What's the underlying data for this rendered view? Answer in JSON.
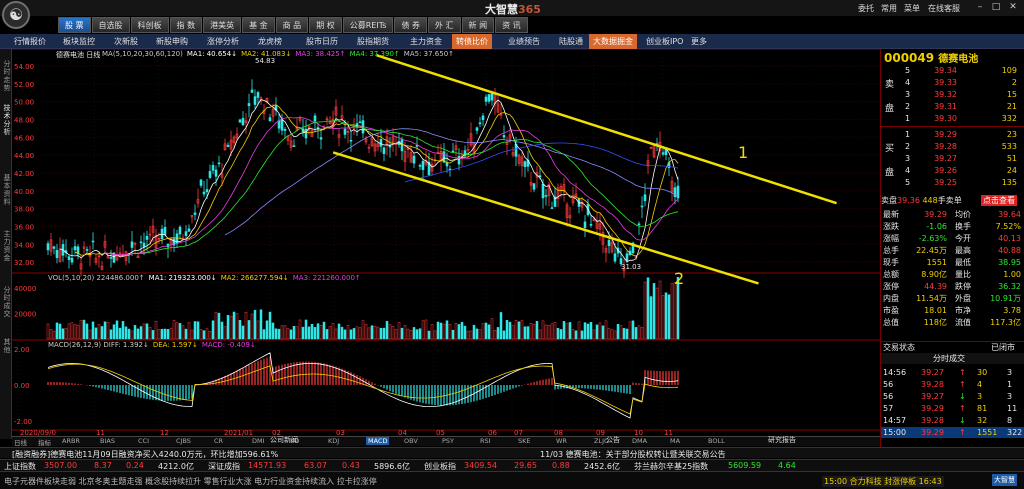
{
  "app": {
    "brand_main": "大智慧",
    "brand_num": "365"
  },
  "window_links": [
    "委托",
    "常用",
    "菜单",
    "在线客服"
  ],
  "menus": [
    "股 票",
    "自选股",
    "科创板",
    "指 数",
    "港美英",
    "基 金",
    "商 品",
    "期 权",
    "公募REITs",
    "债 券",
    "外 汇",
    "新 闻",
    "资 讯"
  ],
  "subtoolbar": [
    "行情报价",
    "板块监控",
    "次新股",
    "新股申购",
    "涨停分析",
    "龙虎榜",
    "股市日历",
    "股指期货",
    "主力资金",
    "转债比价",
    "业绩预告",
    "陆股通",
    "大数据掘金",
    "创业板IPO",
    "更多"
  ],
  "left_tabs": [
    "分时走势",
    "技术分析",
    "基本资料",
    "主力资金",
    "分时成交",
    "其他"
  ],
  "chart": {
    "stock_label": "德赛电池 日线",
    "ma_legend": [
      {
        "text": "MA(5,10,20,30,60,120)",
        "color": "#c8c8c8"
      },
      {
        "text": "MA1: 40.654↓",
        "color": "#ffffff"
      },
      {
        "text": "MA2: 41.083↓",
        "color": "#f0d000"
      },
      {
        "text": "MA3: 38.425↑",
        "color": "#e040e0"
      },
      {
        "text": "MA4: 37.390↑",
        "color": "#2ee62e"
      },
      {
        "text": "MA5: 37.650↑",
        "color": "#c8c8c8"
      }
    ],
    "peak_label": "54.83",
    "low_label": "31.03",
    "price_axis": [
      "54.00",
      "52.00",
      "50.00",
      "48.00",
      "46.00",
      "44.00",
      "42.00",
      "40.00",
      "38.00",
      "36.00",
      "34.00",
      "32.00"
    ],
    "vol_legend": [
      {
        "text": "VOL(5,10,20) 224486.000↑",
        "color": "#c8c8c8"
      },
      {
        "text": "MA1: 219323.000↓",
        "color": "#ffffff"
      },
      {
        "text": "MA2: 266277.594↓",
        "color": "#f0d000"
      },
      {
        "text": "MA3: 221260.000↑",
        "color": "#e040e0"
      }
    ],
    "vol_axis": [
      "40000",
      "20000"
    ],
    "macd_legend": [
      {
        "text": "MACD(26,12,9) DIFF: 1.392↓",
        "color": "#c8c8c8"
      },
      {
        "text": "DEA: 1.597↓",
        "color": "#f0d000"
      },
      {
        "text": "MACD: -0.409↓",
        "color": "#e040e0"
      }
    ],
    "macd_axis": [
      "2.00",
      "0.00",
      "-2.00"
    ],
    "date_labels": [
      "2020/09/0",
      "11",
      "12",
      "2021/01",
      "02",
      "03",
      "04",
      "05",
      "06",
      "07",
      "08",
      "09",
      "10",
      "11"
    ],
    "channel_labels": [
      "1",
      "2"
    ]
  },
  "chart_data": {
    "type": "candlestick",
    "title": "德赛电池 日线",
    "ylabel": "",
    "ylim": [
      31,
      55
    ],
    "upper_line": {
      "points": [
        [
          0.42,
          55.2
        ],
        [
          0.95,
          38.6
        ]
      ]
    },
    "lower_line": {
      "points": [
        [
          0.37,
          44.3
        ],
        [
          0.86,
          29.6
        ]
      ]
    },
    "highlights": {
      "high": 54.83,
      "low": 31.03
    }
  },
  "indicator_tabs": [
    "日线",
    "指标",
    "ARBR",
    "BIAS",
    "CCI",
    "CJBS",
    "CR",
    "DMI",
    "KD",
    "KDJ",
    "MACD",
    "OBV",
    "PSY",
    "RSI",
    "SKE",
    "WR",
    "ZLJC",
    "DMA",
    "MA",
    "BOLL"
  ],
  "bottom_tabs": [
    "公司新闻",
    "公告",
    "研究报告"
  ],
  "quote": {
    "code": "000049",
    "name": "德赛电池",
    "asks": [
      {
        "lvl": "5",
        "price": "39.34",
        "vol": "109"
      },
      {
        "lvl": "4",
        "price": "39.33",
        "vol": "2"
      },
      {
        "lvl": "3",
        "price": "39.32",
        "vol": "15"
      },
      {
        "lvl": "2",
        "price": "39.31",
        "vol": "21"
      },
      {
        "lvl": "1",
        "price": "39.30",
        "vol": "332"
      }
    ],
    "bids": [
      {
        "lvl": "1",
        "price": "39.29",
        "vol": "23"
      },
      {
        "lvl": "2",
        "price": "39.28",
        "vol": "533"
      },
      {
        "lvl": "3",
        "price": "39.27",
        "vol": "51"
      },
      {
        "lvl": "4",
        "price": "39.26",
        "vol": "24"
      },
      {
        "lvl": "5",
        "price": "39.25",
        "vol": "135"
      }
    ],
    "side_ask": "卖",
    "side_bid": "买",
    "side_pan": "盘",
    "sellpan_label": "卖盘",
    "sellpan_price": "39.36",
    "sellpan_vol": "448",
    "sellpan_suffix": "手卖单",
    "sellpan_btn": "点击查看",
    "stats": [
      [
        "最新",
        "39.29",
        "均价",
        "39.64"
      ],
      [
        "涨跌",
        "-1.06",
        "换手",
        "7.52%"
      ],
      [
        "涨幅",
        "-2.63%",
        "今开",
        "40.13"
      ],
      [
        "总手",
        "22.45万",
        "最高",
        "40.88"
      ],
      [
        "现手",
        "1551",
        "最低",
        "38.95"
      ],
      [
        "总额",
        "8.90亿",
        "量比",
        "1.00"
      ],
      [
        "涨停",
        "44.39",
        "跌停",
        "36.32"
      ],
      [
        "内盘",
        "11.54万",
        "外盘",
        "10.91万"
      ],
      [
        "市盈",
        "18.01",
        "市净",
        "3.78"
      ],
      [
        "总值",
        "118亿",
        "流值",
        "117.3亿"
      ]
    ],
    "trade_header": "交易状态",
    "trade_status": "已闭市",
    "ticks_title": "分时成交",
    "ticks": [
      {
        "t": "14:56",
        "p": "39.27",
        "v": "30",
        "n": "3"
      },
      {
        "t": "56",
        "p": "39.28",
        "v": "4",
        "n": "1"
      },
      {
        "t": "56",
        "p": "39.27",
        "v": "3",
        "n": "3"
      },
      {
        "t": "57",
        "p": "39.29",
        "v": "81",
        "n": "11"
      },
      {
        "t": "14:57",
        "p": "39.28",
        "v": "32",
        "n": "8"
      },
      {
        "t": "15:00",
        "p": "39.29",
        "v": "1551",
        "n": "322"
      }
    ]
  },
  "news_bar": "[融资融券]德赛电池11月09日融资净买入4240.0万元，环比增加596.61%",
  "news_suffix": "11/03 德赛电池：关于部分股权转让暨关联交易公告",
  "ticker": [
    {
      "name": "上证指数",
      "val": "3507.00",
      "color": "#ff3b3b"
    },
    {
      "name": "",
      "val": "8.37",
      "color": "#ff3b3b"
    },
    {
      "name": "",
      "val": "0.24",
      "color": "#ff3b3b"
    },
    {
      "name": "",
      "val": "4212.0亿",
      "color": "#e8e8e8"
    },
    {
      "name": "深证成指",
      "val": "14571.93",
      "color": "#ff3b3b"
    },
    {
      "name": "",
      "val": "63.07",
      "color": "#ff3b3b"
    },
    {
      "name": "",
      "val": "0.43",
      "color": "#ff3b3b"
    },
    {
      "name": "",
      "val": "5896.6亿",
      "color": "#e8e8e8"
    },
    {
      "name": "创业板指",
      "val": "3409.54",
      "color": "#ff3b3b"
    },
    {
      "name": "",
      "val": "29.65",
      "color": "#ff3b3b"
    },
    {
      "name": "",
      "val": "0.88",
      "color": "#ff3b3b"
    },
    {
      "name": "",
      "val": "2452.6亿",
      "color": "#e8e8e8"
    },
    {
      "name": "芬兰赫尔辛基25指数",
      "val": "5609.59",
      "color": "#2ee62e"
    },
    {
      "name": "",
      "val": "4.64",
      "color": "#2ee62e"
    }
  ],
  "marquee": "电子元器件板块走弱      北京冬奥主题走强      概念股持续拉升      零售行业大涨      电力行业资金持续流入      拉卡拉涨停",
  "clock": "15:00 合力科技 封涨停板 16:43",
  "brand_badge": "大智慧"
}
